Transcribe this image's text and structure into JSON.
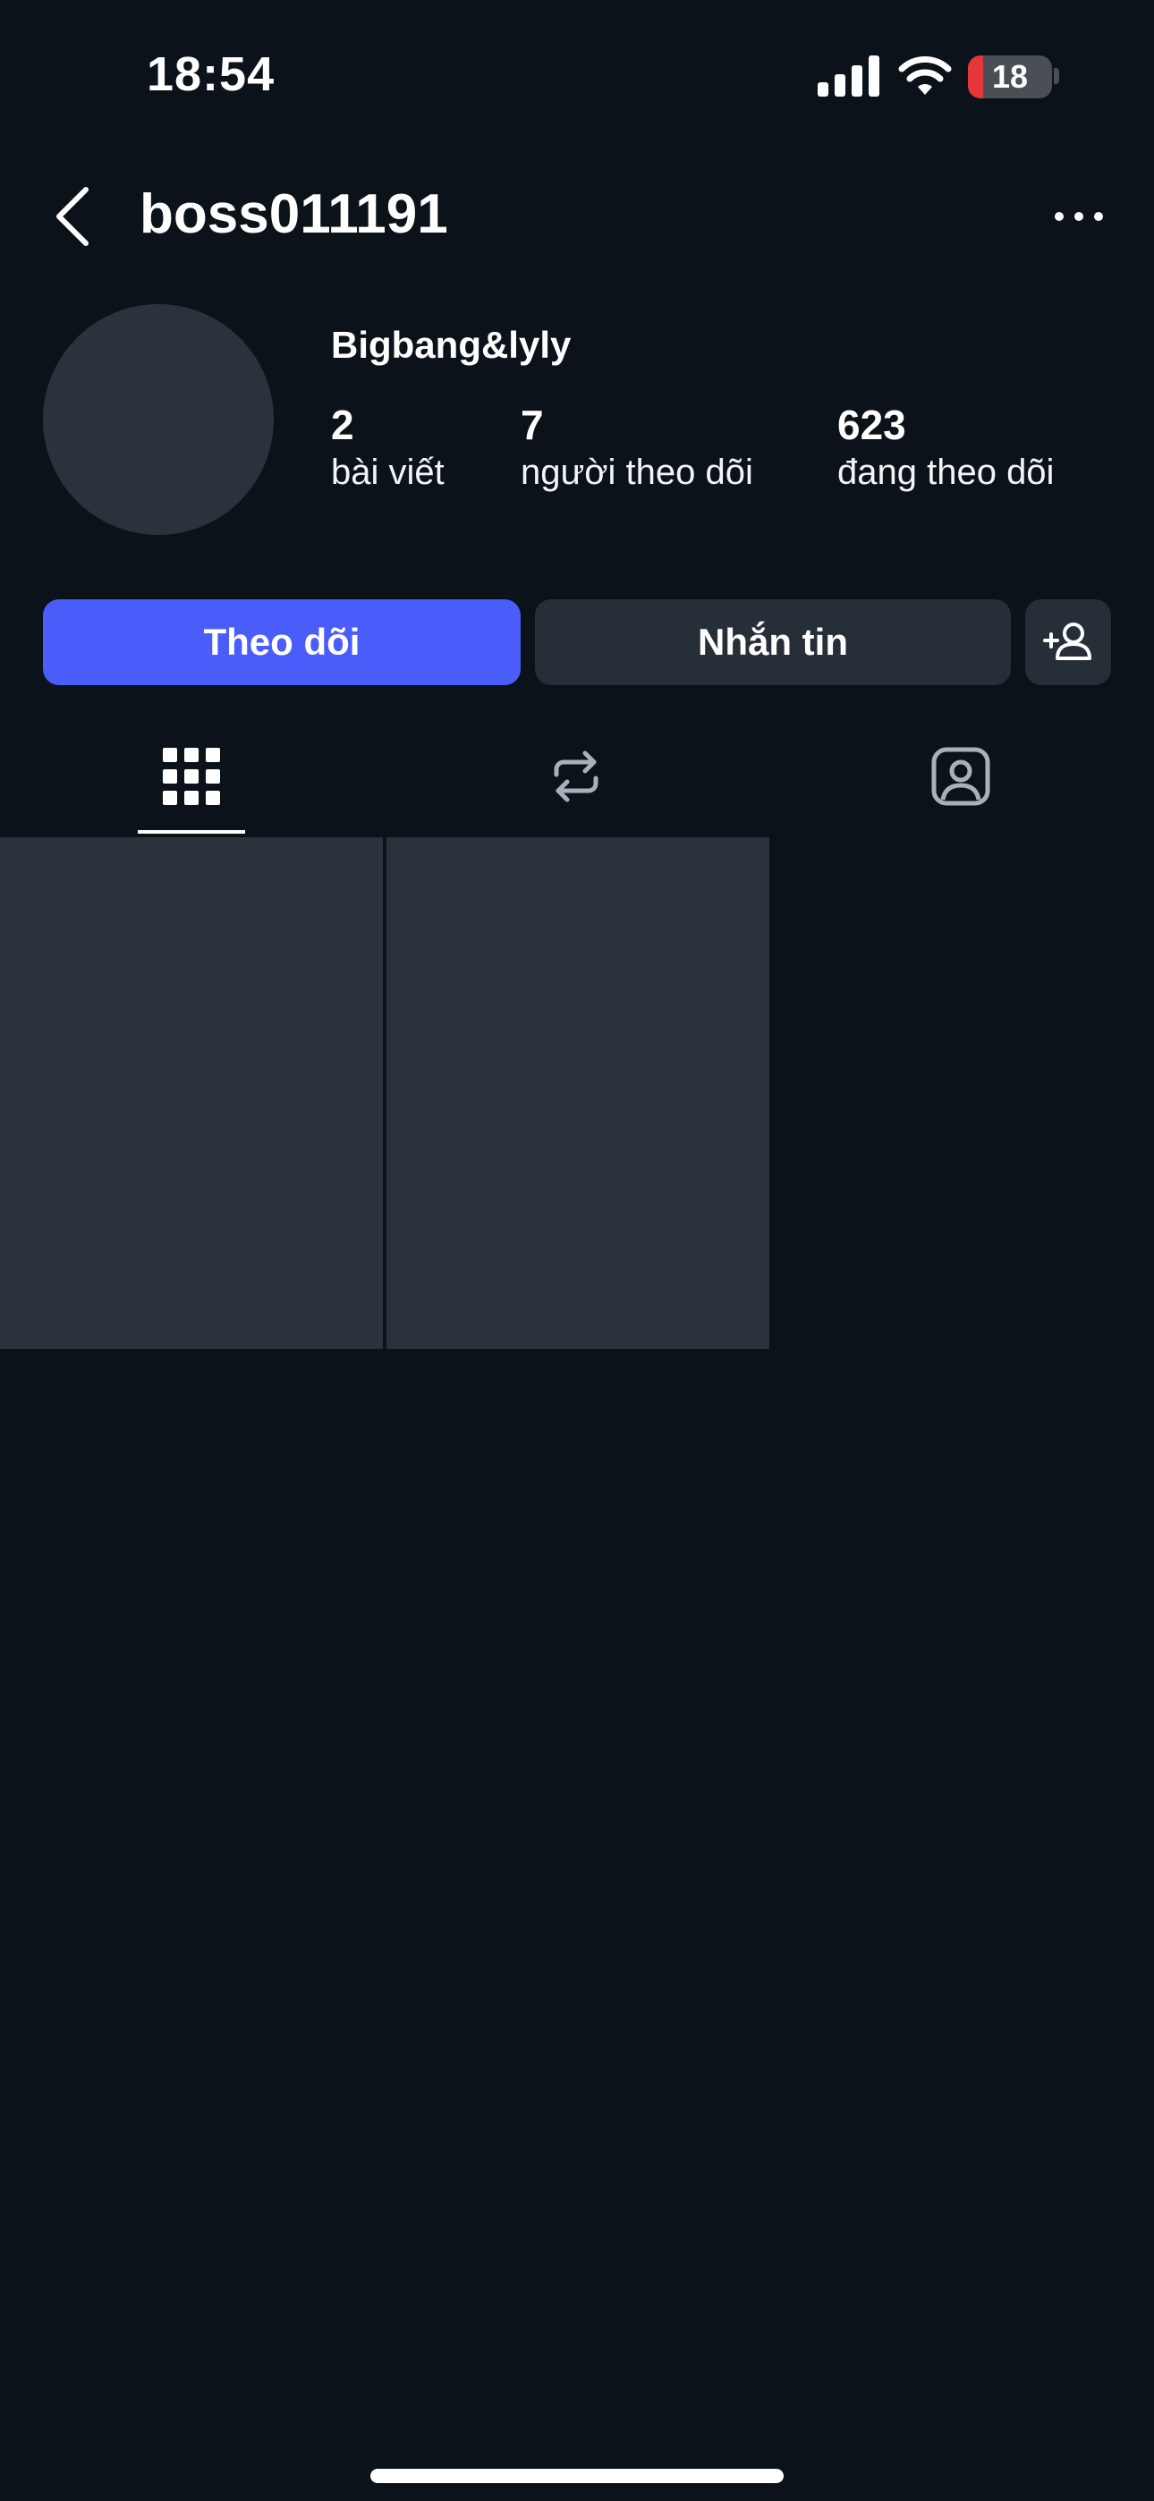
{
  "status_bar": {
    "time": "18:54",
    "battery_level": "18",
    "battery_fraction": 0.18,
    "icons": [
      "cellular-signal-icon",
      "wifi-icon",
      "battery-icon"
    ]
  },
  "header": {
    "username": "boss011191",
    "icons": [
      "back-chevron-icon",
      "more-options-icon"
    ]
  },
  "profile": {
    "display_name": "Bigbang&lyly",
    "stats": [
      {
        "value": "2",
        "label": "bài viết"
      },
      {
        "value": "7",
        "label": "người theo dõi"
      },
      {
        "value": "623",
        "label": "đang theo dõi"
      }
    ]
  },
  "actions": {
    "follow_label": "Theo dõi",
    "message_label": "Nhắn tin",
    "suggest_icon": "add-person-icon"
  },
  "tabs": [
    {
      "icon": "grid-icon",
      "active": true
    },
    {
      "icon": "reposts-icon",
      "active": false
    },
    {
      "icon": "tagged-icon",
      "active": false
    }
  ],
  "colors": {
    "background": "#0b121a",
    "primary_button": "#4a5dfb",
    "secondary_button": "#262e37",
    "battery_low": "#e5363a"
  },
  "posts": [
    {
      "content": "withheld"
    },
    {
      "content": "withheld"
    }
  ]
}
